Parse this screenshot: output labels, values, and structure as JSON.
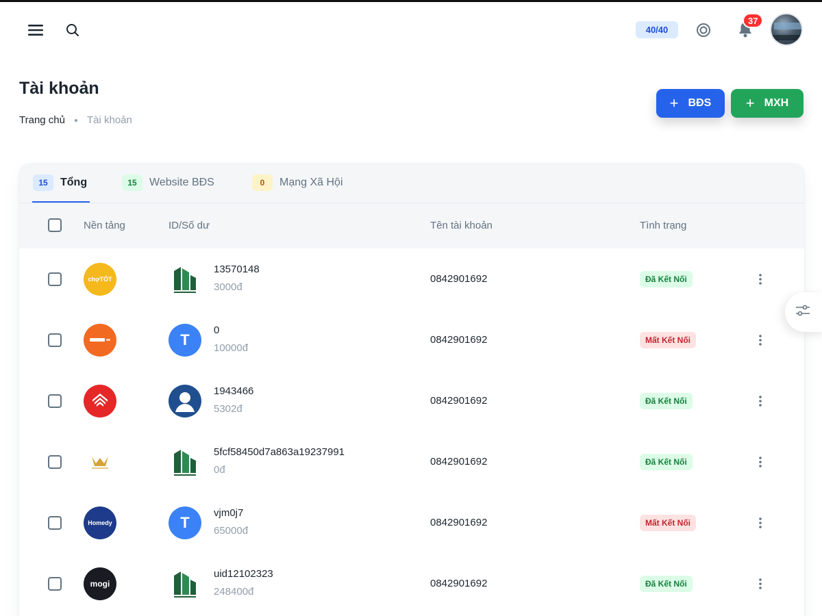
{
  "header": {
    "counter": "40/40",
    "notification_count": "37"
  },
  "page": {
    "title": "Tài khoản",
    "breadcrumb_home": "Trang chủ",
    "breadcrumb_current": "Tài khoản"
  },
  "actions": {
    "add_bds_label": "BĐS",
    "add_mxh_label": "MXH"
  },
  "tabs": [
    {
      "count": "15",
      "label": "Tổng"
    },
    {
      "count": "15",
      "label": "Website BĐS"
    },
    {
      "count": "0",
      "label": "Mạng Xã Hội"
    }
  ],
  "table": {
    "columns": [
      "Nền tảng",
      "ID/Số dư",
      "Tên tài khoản",
      "Tình trạng"
    ],
    "rows": [
      {
        "platform": "chotot-icon",
        "platform_text": "chợTỐT",
        "avatar": "logo",
        "id": "13570148",
        "balance": "3000đ",
        "name": "0842901692",
        "status": "Đã Kết Nối",
        "status_type": "ok"
      },
      {
        "platform": "orange-platform-icon",
        "platform_text": "",
        "avatar": "letter",
        "avatar_letter": "T",
        "id": "0",
        "balance": "10000đ",
        "name": "0842901692",
        "status": "Mất Kết Nối",
        "status_type": "bad"
      },
      {
        "platform": "red-house-icon",
        "platform_text": "",
        "avatar": "user",
        "id": "1943466",
        "balance": "5302đ",
        "name": "0842901692",
        "status": "Đã Kết Nối",
        "status_type": "ok"
      },
      {
        "platform": "gold-logo-icon",
        "platform_text": "",
        "avatar": "logo",
        "id": "5fcf58450d7a863a19237991",
        "balance": "0đ",
        "name": "0842901692",
        "status": "Đã Kết Nối",
        "status_type": "ok"
      },
      {
        "platform": "homedy-icon",
        "platform_text": "Homedy",
        "avatar": "letter",
        "avatar_letter": "T",
        "id": "vjm0j7",
        "balance": "65000đ",
        "name": "0842901692",
        "status": "Mất Kết Nối",
        "status_type": "bad"
      },
      {
        "platform": "mogi-icon",
        "platform_text": "mogi",
        "avatar": "logo",
        "id": "uid12102323",
        "balance": "248400đ",
        "name": "0842901692",
        "status": "Đã Kết Nối",
        "status_type": "ok"
      }
    ]
  },
  "colors": {
    "primary": "#2563eb",
    "success": "#22a55a",
    "danger": "#ff3030"
  }
}
